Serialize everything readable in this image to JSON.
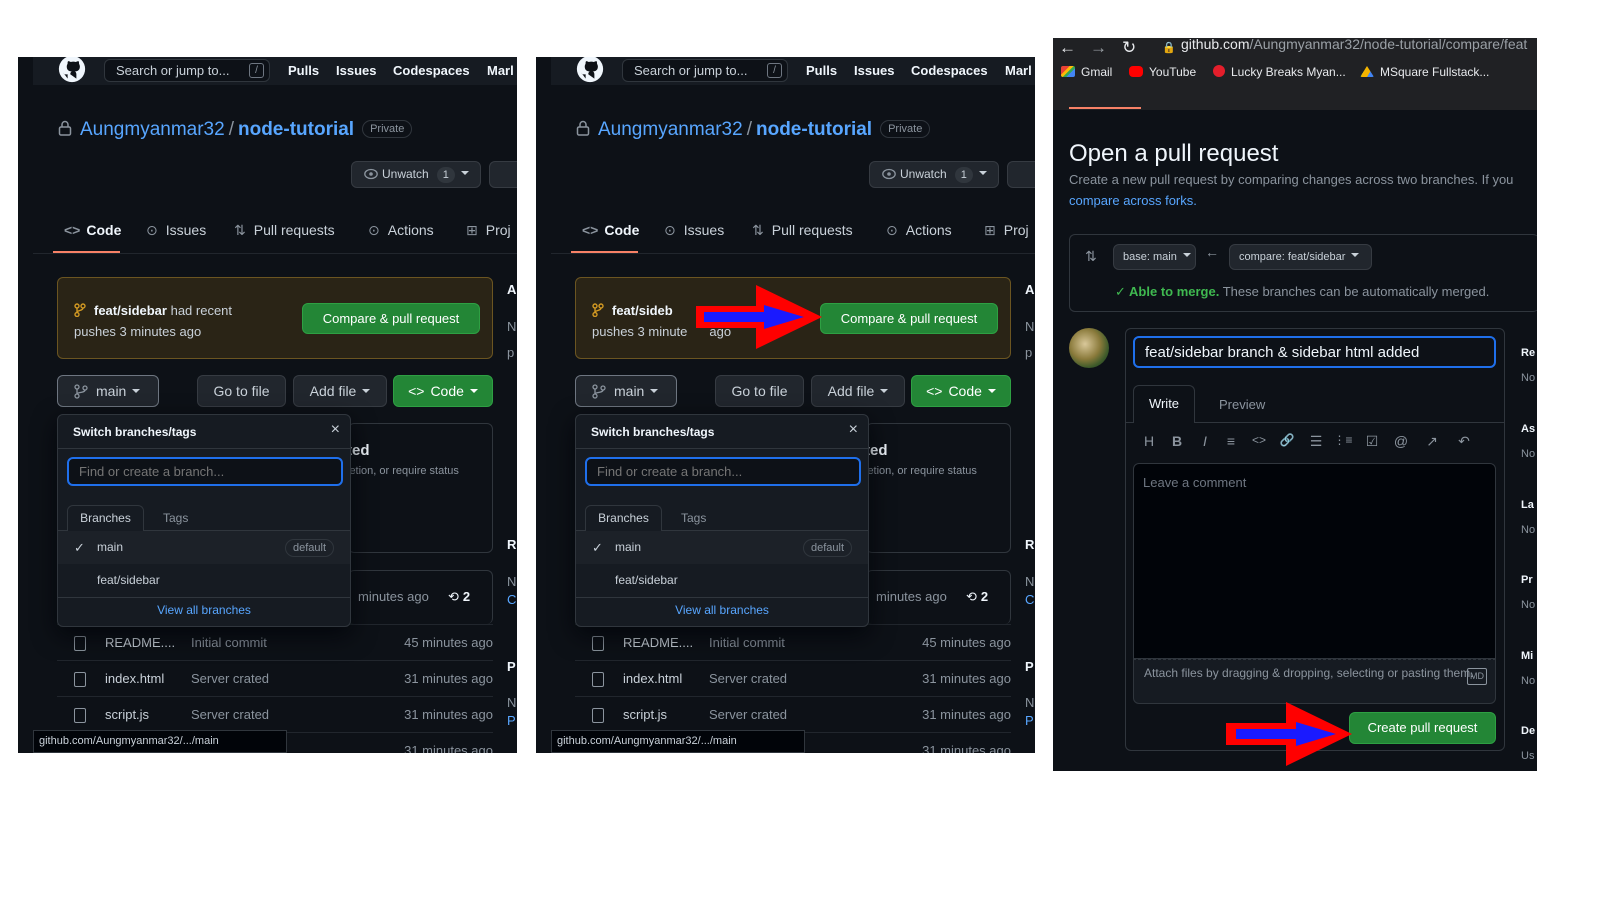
{
  "header": {
    "search_placeholder": "Search or jump to...",
    "slash": "/",
    "nav": [
      "Pulls",
      "Issues",
      "Codespaces",
      "Marl"
    ]
  },
  "repo": {
    "owner": "Aungmyanmar32",
    "separator": "/",
    "name": "node-tutorial",
    "visibility": "Private",
    "watch_label": "Unwatch",
    "watch_count": "1"
  },
  "tabs": [
    "Code",
    "Issues",
    "Pull requests",
    "Actions",
    "Proj"
  ],
  "push_notice": {
    "branch": "feat/sidebar",
    "text_after": " had recent",
    "line2": "pushes 3 minutes ago",
    "p2_branch": "feat/sideb",
    "p2_line2": "pushes 3 minute",
    "p2_line2_tail": "ago",
    "button": "Compare & pull request"
  },
  "toolbar": {
    "branch": "main",
    "go_to_file": "Go to file",
    "add_file": "Add file",
    "code": "Code"
  },
  "behind": {
    "title": "ted",
    "text": "letion, or require status"
  },
  "commits": {
    "text": "minutes ago",
    "count": "2"
  },
  "files": [
    {
      "name": "README....",
      "msg": "Initial commit",
      "time": "45 minutes ago"
    },
    {
      "name": "index.html",
      "msg": "Server crated",
      "time": "31 minutes ago"
    },
    {
      "name": "script.js",
      "msg": "Server crated",
      "time": "31 minutes ago"
    },
    {
      "name": "",
      "msg": "",
      "time": "31 minutes ago"
    }
  ],
  "right_col": [
    "A",
    "N",
    "p",
    "R",
    "N",
    "C",
    "P",
    "N",
    "P"
  ],
  "status_url": "github.com/Aungmyanmar32/.../main",
  "dropdown": {
    "title": "Switch branches/tags",
    "close": "×",
    "placeholder": "Find or create a branch...",
    "tab_branches": "Branches",
    "tab_tags": "Tags",
    "branches": [
      {
        "name": "main",
        "badge": "default",
        "current": true
      },
      {
        "name": "feat/sidebar",
        "badge": "",
        "current": false
      }
    ],
    "view_all": "View all branches"
  },
  "browser": {
    "url_host": "github.com",
    "url_path": "/Aungmyanmar32/node-tutorial/compare/feat",
    "bookmarks": [
      "Gmail",
      "YouTube",
      "Lucky Breaks Myan...",
      "MSquare Fullstack..."
    ]
  },
  "pr": {
    "title": "Open a pull request",
    "subtitle": "Create a new pull request by comparing changes across two branches. If you",
    "link": "compare across forks.",
    "base": "base: main",
    "compare": "compare: feat/sidebar",
    "merge_ok": "Able to merge.",
    "merge_text": " These branches can be automatically merged.",
    "title_value": "feat/sidebar branch & sidebar html added",
    "tab_write": "Write",
    "tab_preview": "Preview",
    "tools": [
      "H",
      "B",
      "I",
      "≡",
      "<>",
      "🔗",
      "☰",
      "⋮≡",
      "☑",
      "@",
      "↗",
      "↶"
    ],
    "comment_placeholder": "Leave a comment",
    "attach_text": "Attach files by dragging & dropping, selecting or pasting them.",
    "md": "MD",
    "create_button": "Create pull request",
    "sidebar": [
      {
        "label": "Re",
        "value": "No"
      },
      {
        "label": "As",
        "value": "No"
      },
      {
        "label": "La",
        "value": "No"
      },
      {
        "label": "Pr",
        "value": "No"
      },
      {
        "label": "Mi",
        "value": "No"
      },
      {
        "label": "De",
        "value": "Us"
      }
    ]
  },
  "colors": {
    "arrow_outer": "#ff0000",
    "arrow_inner": "#1a1aff",
    "green": "#238636",
    "link": "#58a6ff"
  }
}
